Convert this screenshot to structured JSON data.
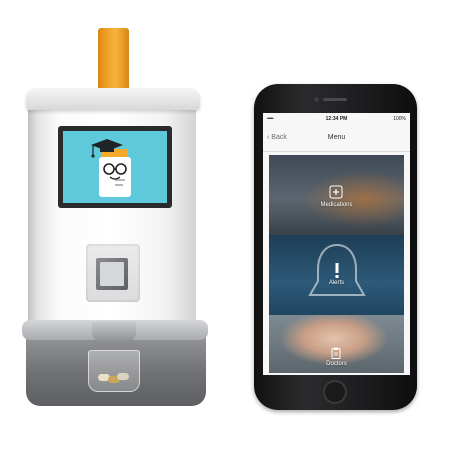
{
  "phone": {
    "status": {
      "carrier": "•••••",
      "time": "12:34 PM",
      "battery": "100%"
    },
    "nav": {
      "back_label": "Back",
      "title": "Menu"
    },
    "menu_items": [
      {
        "label": "Medications",
        "icon": "pill-bottle-icon"
      },
      {
        "label": "Alerts",
        "icon": "bell-alert-icon"
      },
      {
        "label": "Doctors",
        "icon": "clipboard-icon"
      }
    ]
  },
  "dispenser": {
    "screen_icon": "graduate-pill-bottle-icon",
    "colors": {
      "display": "#5fc9dc",
      "pill_tube": "#f4a82c"
    }
  }
}
